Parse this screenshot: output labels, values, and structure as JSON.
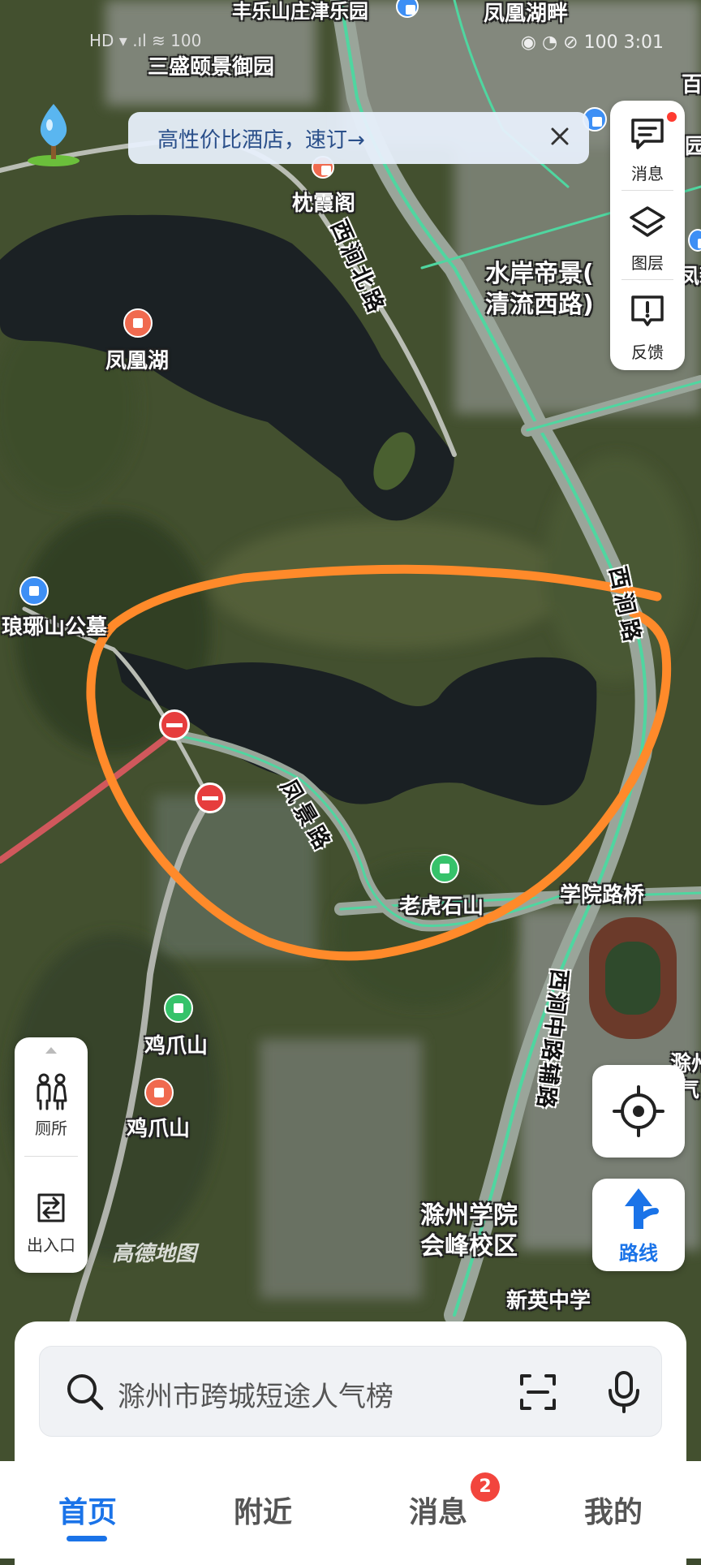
{
  "status_bar": {
    "left_text": "HD ▾ .ıl ≋ 100",
    "right_text": "◉ ◔ ⊘ 100 3:01"
  },
  "promo": {
    "text": "高性价比酒店，速订→"
  },
  "side_panel": {
    "message_label": "消息",
    "layers_label": "图层",
    "feedback_label": "反馈"
  },
  "map_labels": {
    "top_park": "丰乐山庄津乐园",
    "top_right": "凤凰湖畔",
    "sansheng": "三盛颐景御园",
    "zhenxia": "枕霞阁",
    "xijian_north": "西涧北路",
    "shuian_1": "水岸帝景(",
    "shuian_2": "清流西路)",
    "fenghuang_lake": "凤凰湖",
    "langshan_cemetery": "琅琊山公墓",
    "xijian_road": "西涧路",
    "fengjing_road": "凤景路",
    "laohushi": "老虎石山",
    "xueyuan_bridge": "学院路桥",
    "xijian_middle_aux": "西涧中路辅路",
    "jizhua_mountain_1": "鸡爪山",
    "jizhua_mountain_2": "鸡爪山",
    "chuzhou_college_1": "滁州学院",
    "chuzhou_college_2": "会峰校区",
    "xinying_school": "新英中学",
    "edge_right_1": "百",
    "edge_right_2": "凤新",
    "edge_right_3": "园",
    "edge_right_4": "滁州",
    "edge_right_5": "气"
  },
  "left_panel": {
    "toilet_label": "厕所",
    "entrance_label": "出入口"
  },
  "route_label": "路线",
  "watermark": "高德地图",
  "search": {
    "placeholder": "滁州市跨城短途人气榜"
  },
  "tabs": {
    "home": "首页",
    "nearby": "附近",
    "messages": "消息",
    "mine": "我的",
    "messages_badge": "2"
  },
  "colors": {
    "accent": "#1a73e8",
    "annotation": "#ff8a2a",
    "road": "#4fd6a0",
    "badge": "#f2453d"
  }
}
